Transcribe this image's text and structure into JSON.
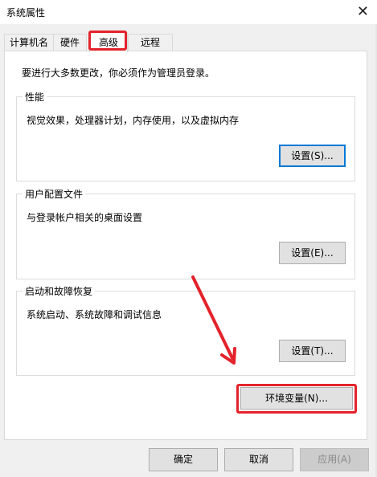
{
  "window": {
    "title": "系统属性",
    "close_symbol": "✕"
  },
  "tabs": [
    {
      "label": "计算机名"
    },
    {
      "label": "硬件"
    },
    {
      "label": "高级",
      "active": true
    },
    {
      "label": "远程"
    }
  ],
  "intro": "要进行大多数更改，你必须作为管理员登录。",
  "performance": {
    "title": "性能",
    "desc": "视觉效果，处理器计划，内存使用，以及虚拟内存",
    "button": "设置(S)..."
  },
  "profiles": {
    "title": "用户配置文件",
    "desc": "与登录帐户相关的桌面设置",
    "button": "设置(E)..."
  },
  "startup": {
    "title": "启动和故障恢复",
    "desc": "系统启动、系统故障和调试信息",
    "button": "设置(T)..."
  },
  "env_button": "环境变量(N)...",
  "footer": {
    "ok": "确定",
    "cancel": "取消",
    "apply": "应用(A)"
  },
  "colors": {
    "highlight": "#e3232b",
    "focus": "#0078d7"
  }
}
